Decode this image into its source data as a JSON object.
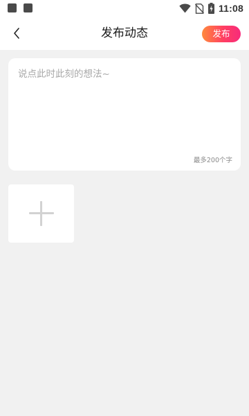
{
  "status_bar": {
    "time": "11:08",
    "icons": [
      "notification-square-icon",
      "notification-square-icon",
      "wifi-icon",
      "no-sim-icon",
      "battery-charging-icon"
    ]
  },
  "nav_bar": {
    "back_icon": "chevron-left-icon",
    "title": "发布动态",
    "publish_label": "发布"
  },
  "compose": {
    "placeholder": "说点此时此刻的想法~",
    "value": "",
    "char_limit_hint": "最多200个字"
  },
  "media": {
    "add_icon": "plus-icon"
  },
  "colors": {
    "page_background": "#f1f1f1",
    "card_background": "#ffffff",
    "publish_gradient": [
      "#ff8a3d",
      "#ff3f62",
      "#f72b7b"
    ],
    "placeholder_text": "#a8a8a8"
  }
}
